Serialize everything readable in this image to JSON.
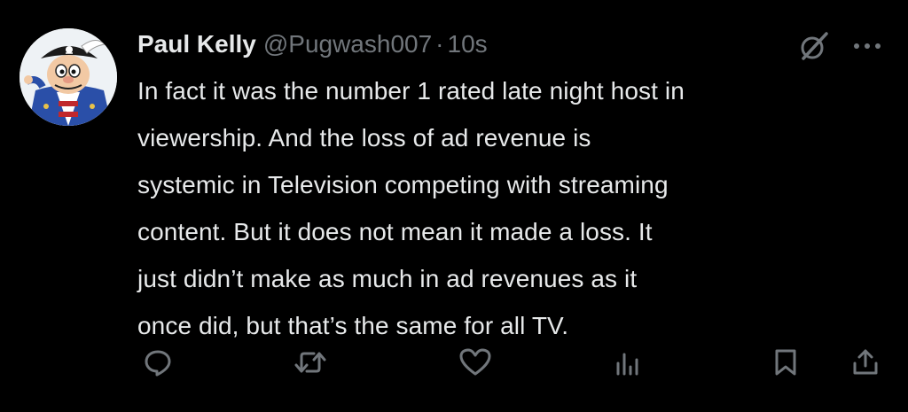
{
  "tweet": {
    "author_name": "Paul Kelly",
    "handle": "@Pugwash007",
    "separator": "·",
    "time": "10s",
    "text": "In fact it was the number 1 rated late night host in\nviewership. And the loss of ad revenue is\nsystemic in Television competing with streaming\ncontent. But it does not mean it made a loss. It\njust didn’t make as much in ad revenues as it\nonce did, but that’s the same for all TV."
  },
  "icons": {
    "grok": "grok-icon",
    "more": "more-icon",
    "reply": "reply-icon",
    "retweet": "retweet-icon",
    "like": "like-icon",
    "views": "views-icon",
    "bookmark": "bookmark-icon",
    "share": "share-icon"
  },
  "colors": {
    "background": "#000000",
    "text": "#e7e9ea",
    "muted": "#71767b"
  }
}
